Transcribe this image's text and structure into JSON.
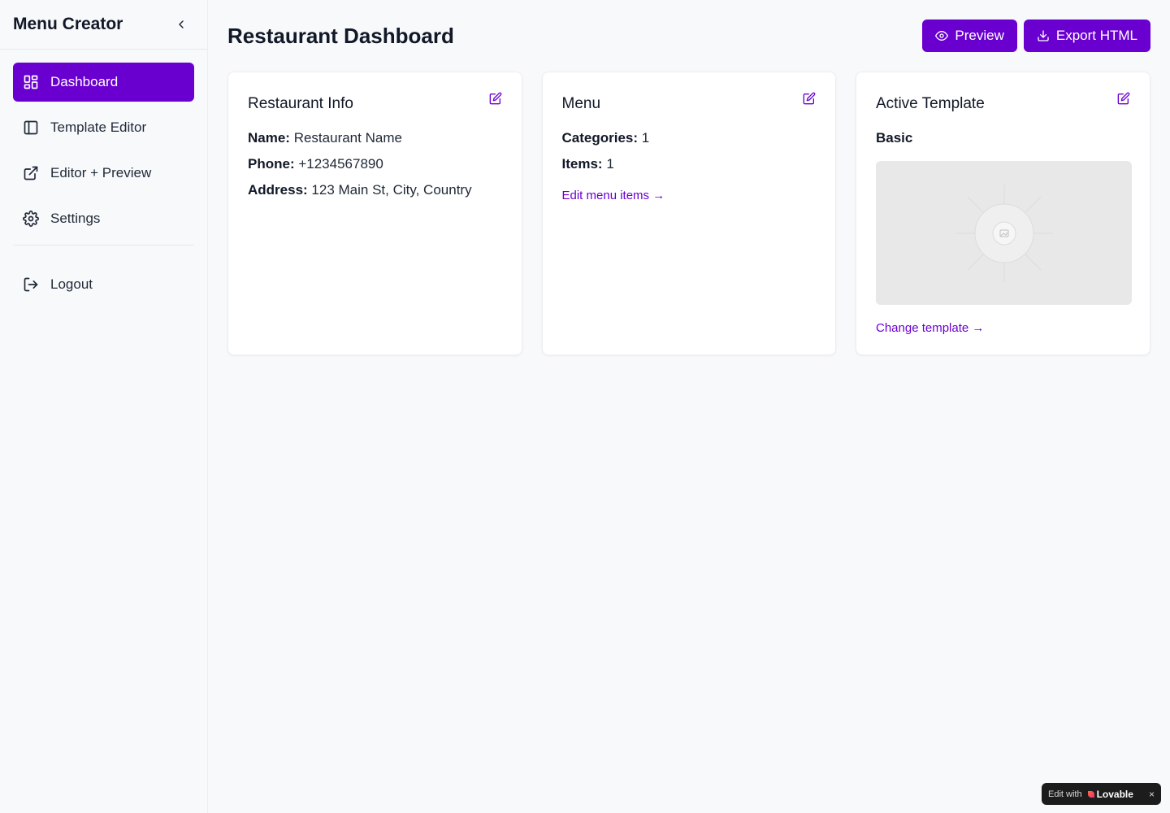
{
  "sidebar": {
    "title": "Menu Creator",
    "nav": [
      {
        "label": "Dashboard",
        "icon": "layout-dashboard-icon",
        "active": true
      },
      {
        "label": "Template Editor",
        "icon": "panel-left-icon",
        "active": false
      },
      {
        "label": "Editor + Preview",
        "icon": "external-link-icon",
        "active": false
      },
      {
        "label": "Settings",
        "icon": "gear-icon",
        "active": false
      }
    ],
    "logout": "Logout"
  },
  "header": {
    "title": "Restaurant Dashboard",
    "preview_label": "Preview",
    "export_label": "Export HTML"
  },
  "cards": {
    "info": {
      "title": "Restaurant Info",
      "name_label": "Name:",
      "name_value": "Restaurant Name",
      "phone_label": "Phone:",
      "phone_value": "+1234567890",
      "address_label": "Address:",
      "address_value": "123 Main St, City, Country"
    },
    "menu": {
      "title": "Menu",
      "categories_label": "Categories:",
      "categories_value": "1",
      "items_label": "Items:",
      "items_value": "1",
      "link": "Edit menu items →"
    },
    "template": {
      "title": "Active Template",
      "name": "Basic",
      "link": "Change template →"
    }
  },
  "badge": {
    "prefix": "Edit with",
    "brand": "Lovable",
    "close": "×"
  },
  "colors": {
    "accent": "#6a00d0",
    "background": "#f8f9fb"
  }
}
